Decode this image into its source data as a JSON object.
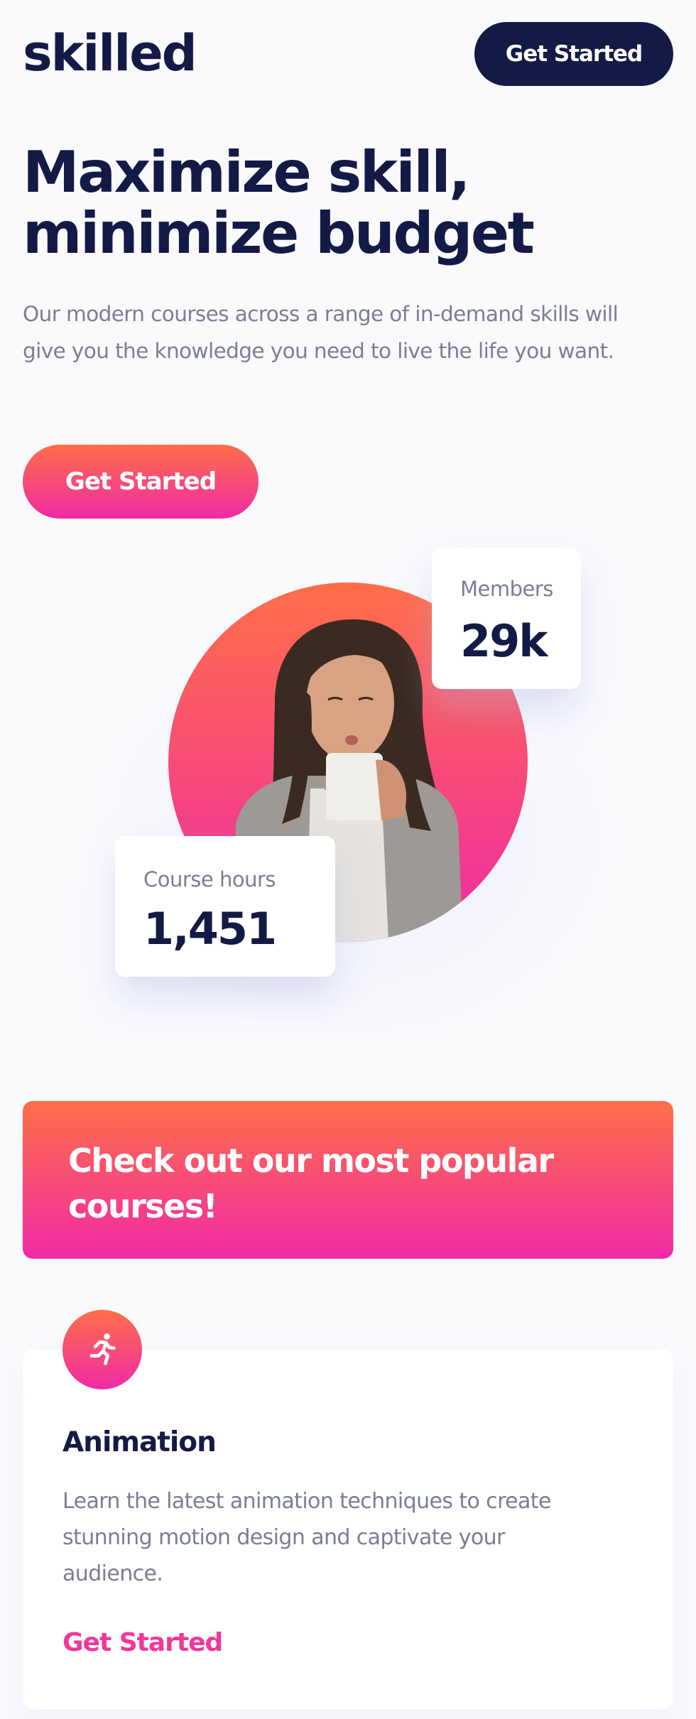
{
  "brand": {
    "logo": "skilled"
  },
  "header": {
    "cta_label": "Get Started"
  },
  "hero": {
    "title_line1": "Maximize skill,",
    "title_line2": "minimize budget",
    "description": "Our modern courses across a range of in-demand skills will give you the knowledge you need to live the life you want.",
    "cta_label": "Get Started"
  },
  "stats": {
    "members": {
      "label": "Members",
      "value": "29k"
    },
    "course_hours": {
      "label": "Course hours",
      "value": "1,451"
    }
  },
  "popular": {
    "title": "Check out our most popular courses!"
  },
  "courses": [
    {
      "icon": "running-person-icon",
      "title": "Animation",
      "description": "Learn the latest animation techniques to create stunning motion design and captivate your audience.",
      "link_label": "Get Started"
    }
  ],
  "colors": {
    "navy": "#131a45",
    "gradient_start": "#ff6f48",
    "gradient_end": "#f02aa6",
    "text_muted": "#7a7d96",
    "link_pink": "#f2379a"
  }
}
